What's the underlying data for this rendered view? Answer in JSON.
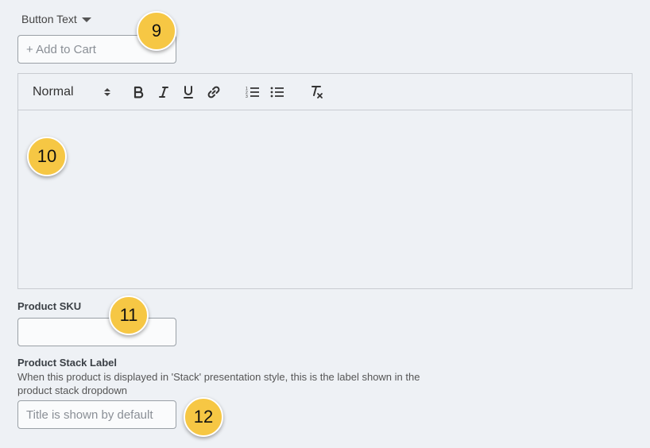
{
  "button_text": {
    "label": "Button Text",
    "placeholder": "+ Add to Cart"
  },
  "editor": {
    "format_value": "Normal",
    "tools": [
      "bold-icon",
      "italic-icon",
      "underline-icon",
      "link-icon",
      "ordered-list-icon",
      "bullet-list-icon",
      "clear-format-icon"
    ]
  },
  "sku": {
    "label": "Product SKU",
    "value": ""
  },
  "stack_label": {
    "label": "Product Stack Label",
    "help": "When this product is displayed in 'Stack' presentation style, this is the label shown in the product stack dropdown",
    "placeholder": "Title is shown by default"
  },
  "callouts": [
    "9",
    "10",
    "11",
    "12"
  ],
  "colors": {
    "background": "#eef1f5",
    "callout": "#f6c744",
    "border": "#9aa0a6"
  }
}
